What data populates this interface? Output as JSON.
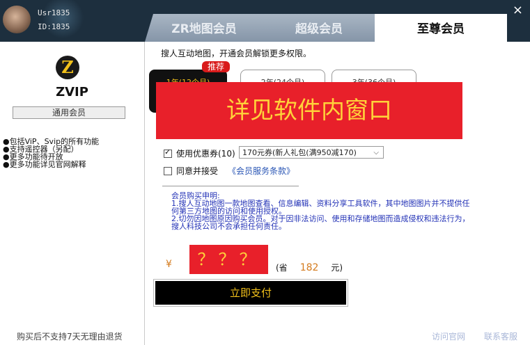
{
  "header": {
    "username": "Usr1835",
    "user_id": "ID:1835",
    "tabs": [
      {
        "label": "ZR地图会员",
        "active": false
      },
      {
        "label": "超级会员",
        "active": false
      },
      {
        "label": "至尊会员",
        "active": true
      }
    ],
    "close_icon": "×"
  },
  "sidebar": {
    "logo_letter": "Z",
    "title": "ZVIP",
    "common_member_label": "通用会员",
    "features": [
      "●包括ViP、Svip的所有功能",
      "●支持遥控器（另配）",
      "●更多功能待开放",
      "●更多功能详见官网解释"
    ],
    "bottom_note": "购买后不支持7天无理由退货"
  },
  "main": {
    "intro": "搜人互动地图，开通会员解锁更多权限。",
    "plans": [
      {
        "label": "1年(12个月)",
        "selected": true
      },
      {
        "label": "2年(24个月)",
        "selected": false
      },
      {
        "label": "3年(36个月)",
        "selected": false
      }
    ],
    "recommend_badge": "推荐",
    "overlay_text": "详见软件内窗口",
    "coupon_checkbox_label": "使用优惠券(10)",
    "coupon_checked": true,
    "coupon_select_value": "170元券(新人礼包(满950减170)",
    "agree_label": "同意并接受",
    "terms_link": "《会员服务条款》",
    "agree_checked": false,
    "statement": [
      "会员购买申明:",
      "1.搜人互动地图一款地图查看、信息编辑、资料分享工具软件，其中地图图片并不提供任",
      "何第三方地图的访问和使用授权。",
      "2.切勿因地图原因购买会员。对于因非法访问、使用和存储地图而造成侵权和违法行为，",
      "搜人科技公司不会承担任何责任。"
    ],
    "yen_symbol": "¥",
    "price_text": "？？？",
    "save_prefix": "(省",
    "save_amount": "182",
    "save_suffix": "元)",
    "pay_button": "立即支付"
  },
  "footer": {
    "official_site": "访问官网",
    "contact_service": "联系客服"
  }
}
